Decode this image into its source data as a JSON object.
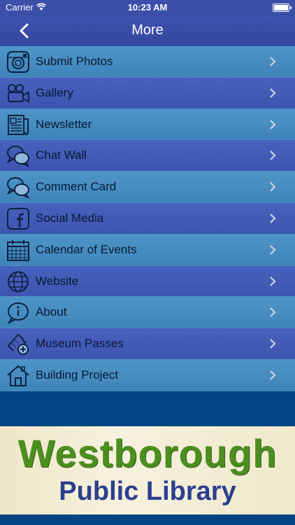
{
  "status_bar": {
    "carrier": "Carrier",
    "time": "10:23 AM"
  },
  "navbar": {
    "title": "More",
    "back_icon": "chevron-left-icon"
  },
  "menu": [
    {
      "label": "Submit Photos",
      "icon": "camera-icon"
    },
    {
      "label": "Gallery",
      "icon": "video-camera-icon"
    },
    {
      "label": "Newsletter",
      "icon": "newspaper-icon"
    },
    {
      "label": "Chat Wall",
      "icon": "chat-bubbles-icon"
    },
    {
      "label": "Comment Card",
      "icon": "comment-bubbles-icon"
    },
    {
      "label": "Social Media",
      "icon": "facebook-icon"
    },
    {
      "label": "Calendar of Events",
      "icon": "calendar-icon"
    },
    {
      "label": "Website",
      "icon": "globe-icon"
    },
    {
      "label": "About",
      "icon": "info-bubble-icon"
    },
    {
      "label": "Museum Passes",
      "icon": "ticket-add-icon"
    },
    {
      "label": "Building Project",
      "icon": "house-icon"
    }
  ],
  "banner": {
    "line1": "Westborough",
    "line2": "Public Library"
  },
  "colors": {
    "navbar": "#3c52ae",
    "row_light": "#4e95c7",
    "row_dark": "#4761bd",
    "background": "#034582"
  }
}
